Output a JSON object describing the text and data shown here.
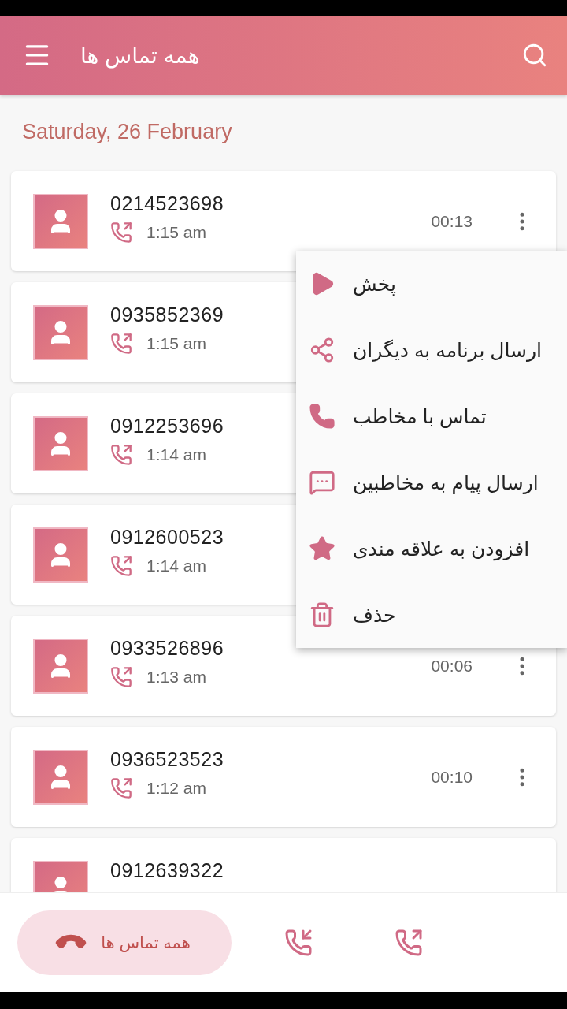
{
  "header": {
    "title": "همه تماس ها"
  },
  "date": "Saturday, 26 February",
  "calls": [
    {
      "kind": "outgoing",
      "number": "0214523698",
      "time": "1:15 am",
      "duration": "00:13"
    },
    {
      "kind": "outgoing",
      "number": "0935852369",
      "time": "1:15 am"
    },
    {
      "kind": "outgoing",
      "number": "0912253696",
      "time": "1:14 am"
    },
    {
      "kind": "outgoing",
      "number": "0912600523",
      "time": "1:14 am"
    },
    {
      "kind": "outgoing",
      "number": "0933526896",
      "time": "1:13 am",
      "duration": "00:06"
    },
    {
      "kind": "outgoing",
      "number": "0936523523",
      "time": "1:12 am",
      "duration": "00:10"
    },
    {
      "number": "0912639322"
    }
  ],
  "context_menu": [
    {
      "kind": "play",
      "label": "پخش"
    },
    {
      "kind": "share",
      "label": "ارسال برنامه به دیگران"
    },
    {
      "kind": "call",
      "label": "تماس با مخاطب"
    },
    {
      "kind": "message",
      "label": "ارسال پیام به مخاطبین"
    },
    {
      "kind": "favorite",
      "label": "افزودن به علاقه مندی"
    },
    {
      "kind": "delete",
      "label": "حذف"
    }
  ],
  "bottom_tabs": [
    {
      "kind": "all",
      "label": "همه تماس ها",
      "selected": true
    },
    {
      "kind": "incoming",
      "selected": false
    },
    {
      "kind": "outgoing",
      "selected": false
    }
  ]
}
